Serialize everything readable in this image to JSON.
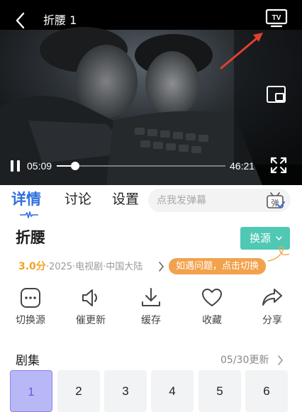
{
  "player": {
    "title": "折腰 1",
    "current_time": "05:09",
    "total_time": "46:21",
    "progress": 0.111
  },
  "tabs": [
    {
      "label": "详情",
      "active": true
    },
    {
      "label": "讨论",
      "active": false
    },
    {
      "label": "设置",
      "active": false
    }
  ],
  "danmu": {
    "placeholder": "点我发弹幕",
    "icon_text": "弹"
  },
  "show": {
    "title": "折腰",
    "switch_source_label": "换源",
    "score": "3.0分",
    "meta": "·2025·电视剧·中国大陆",
    "problem_tip": "如遇问题，点击切换"
  },
  "actions": [
    {
      "label": "切换源",
      "icon": "switch-source-icon"
    },
    {
      "label": "催更新",
      "icon": "speaker-icon"
    },
    {
      "label": "缓存",
      "icon": "download-icon"
    },
    {
      "label": "收藏",
      "icon": "heart-icon"
    },
    {
      "label": "分享",
      "icon": "share-icon"
    }
  ],
  "episodes": {
    "header": "剧集",
    "update_text": "05/30更新",
    "items": [
      {
        "label": "1",
        "active": true
      },
      {
        "label": "2",
        "active": false
      },
      {
        "label": "3",
        "active": false
      },
      {
        "label": "4",
        "active": false
      },
      {
        "label": "5",
        "active": false
      },
      {
        "label": "6",
        "active": false
      }
    ]
  },
  "colors": {
    "accent_blue": "#2f6fe0",
    "switch_green": "#4fc8b4",
    "tip_orange": "#f2a24d",
    "score_orange": "#f2a223",
    "arrow_red": "#e0402e",
    "episode_active": "#b8b8f6"
  }
}
